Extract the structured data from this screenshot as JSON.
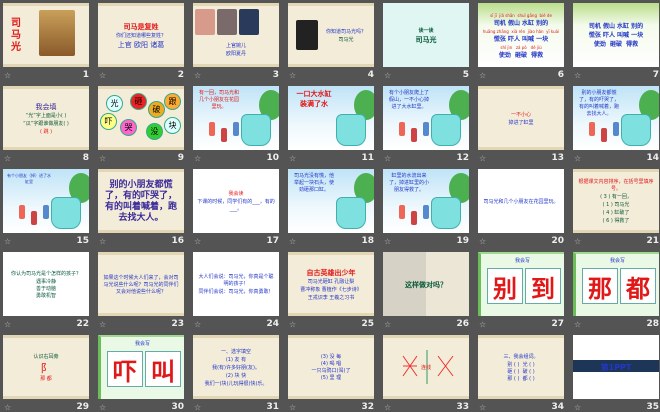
{
  "view": "slide-sorter",
  "slides": [
    {
      "number": "1",
      "theme": "parch",
      "texts": [
        {
          "v": "司\n马\n光",
          "c": "red big",
          "s": 10
        }
      ],
      "extra": "portrait"
    },
    {
      "number": "2",
      "theme": "parch",
      "texts": [
        {
          "v": "司马是复姓",
          "c": "red big",
          "s": 7
        },
        {
          "v": "你们还知道哪些复姓？",
          "c": "blue",
          "s": 5
        },
        {
          "v": "上官 欧阳 诸葛",
          "c": "blue",
          "s": 7
        }
      ]
    },
    {
      "number": "3",
      "theme": "parch",
      "texts": [
        {
          "v": "上官婉儿",
          "c": "blue",
          "s": 5
        },
        {
          "v": "欧阳夏丹",
          "c": "blue",
          "s": 5
        }
      ],
      "extra": "photos"
    },
    {
      "number": "4",
      "theme": "parch",
      "texts": [
        {
          "v": "你知道司马光吗？",
          "c": "blue",
          "s": 5
        },
        {
          "v": "司马光",
          "c": "dk",
          "s": 5
        }
      ],
      "extra": "portrait2"
    },
    {
      "number": "5",
      "theme": "mint",
      "texts": [
        {
          "v": "读一读",
          "c": "dk big",
          "s": 5
        },
        {
          "v": "司马光",
          "c": "dk big",
          "s": 7
        }
      ]
    },
    {
      "number": "6",
      "theme": "leaf",
      "texts": [
        {
          "v": "sī jī  jiǎ shān  shuǐ gāng  bié de",
          "c": "red",
          "s": 4
        },
        {
          "v": "司机 假山 水缸 别的",
          "c": "blue big",
          "s": 6
        },
        {
          "v": "huāng zhāng  xià rén  jiào hǎn  yī kuài",
          "c": "red",
          "s": 4
        },
        {
          "v": "慌张 吓人 叫喊 一块",
          "c": "blue big",
          "s": 6
        },
        {
          "v": "shǐ jìn   zá pò   dé jiù",
          "c": "red",
          "s": 4
        },
        {
          "v": "使劲  砸破  得救",
          "c": "blue big",
          "s": 6
        }
      ]
    },
    {
      "number": "7",
      "theme": "leaf",
      "texts": [
        {
          "v": "司机 假山 水缸 别的",
          "c": "blue big",
          "s": 6
        },
        {
          "v": "慌张 吓人 叫喊 一块",
          "c": "blue big",
          "s": 6
        },
        {
          "v": "使劲  砸破  得救",
          "c": "blue big",
          "s": 6
        }
      ]
    },
    {
      "number": "8",
      "theme": "parch",
      "texts": [
        {
          "v": "我会填",
          "c": "pur",
          "s": 7
        },
        {
          "v": "“光”字上面是小( )",
          "c": "dk",
          "s": 5
        },
        {
          "v": "“瓜”字跟谁做朋友( )",
          "c": "dk",
          "s": 5
        },
        {
          "v": "( 跳 )",
          "c": "red",
          "s": 5
        }
      ]
    },
    {
      "number": "9",
      "theme": "parch",
      "texts": [],
      "extra": "circles",
      "circles": [
        "光",
        "砸",
        "破",
        "跟",
        "吓",
        "哭",
        "没",
        "块"
      ]
    },
    {
      "number": "10",
      "theme": "sky",
      "texts": [
        {
          "v": "有一回，司马光和几个小朋友在花园里玩。",
          "c": "red",
          "s": 5
        }
      ],
      "extra": "scene"
    },
    {
      "number": "11",
      "theme": "sky",
      "texts": [
        {
          "v": "一口大水缸",
          "c": "red big",
          "s": 7
        },
        {
          "v": "装满了水",
          "c": "red big",
          "s": 7
        }
      ],
      "extra": "jar"
    },
    {
      "number": "12",
      "theme": "sky",
      "texts": [
        {
          "v": "有个小朋友爬上了假山，一不小心掉进了大水缸里。",
          "c": "blue",
          "s": 5
        }
      ],
      "extra": "scene"
    },
    {
      "number": "13",
      "theme": "parch",
      "texts": [
        {
          "v": "一不小心",
          "c": "red",
          "s": 5
        },
        {
          "v": "掉进了缸里",
          "c": "blue",
          "s": 5
        }
      ]
    },
    {
      "number": "14",
      "theme": "sky",
      "texts": [
        {
          "v": "别的小朋友都慌了，有的吓哭了，有的叫着喊着，跑去找大人。",
          "c": "blue",
          "s": 5
        }
      ],
      "extra": "scene"
    },
    {
      "number": "15",
      "theme": "sky",
      "texts": [
        {
          "v": "有个小朋友（掉）进了水缸里",
          "c": "blue",
          "s": 4
        }
      ],
      "extra": "scene"
    },
    {
      "number": "16",
      "theme": "parch",
      "texts": [
        {
          "v": "别的小朋友都慌了，有的吓哭了，有的叫着喊着，跑去找大人。",
          "c": "pur big",
          "s": 9
        }
      ]
    },
    {
      "number": "17",
      "theme": "white",
      "texts": [
        {
          "v": "我会读",
          "c": "red",
          "s": 5
        },
        {
          "v": "下课的时候，同学们有的___，有的___。",
          "c": "blue",
          "s": 5
        }
      ]
    },
    {
      "number": "18",
      "theme": "sky",
      "texts": [
        {
          "v": "司马光没有慌，他举起一块石头，使劲砸那口缸。",
          "c": "blue",
          "s": 5
        }
      ],
      "extra": "jar"
    },
    {
      "number": "19",
      "theme": "sky",
      "texts": [
        {
          "v": "缸里的水流出来了，掉进缸里的小朋友得救了。",
          "c": "blue",
          "s": 5
        }
      ],
      "extra": "scene"
    },
    {
      "number": "20",
      "theme": "white",
      "texts": [
        {
          "v": "司马光和几个小朋友在花园里玩。",
          "c": "blue",
          "s": 5
        }
      ]
    },
    {
      "number": "21",
      "theme": "parch",
      "texts": [
        {
          "v": "根据课文内容排序，在括号里填序号。",
          "c": "red",
          "s": 5
        },
        {
          "v": "( 3 ) 有一回，",
          "c": "dk",
          "s": 5
        },
        {
          "v": "( 1 ) 司马光",
          "c": "dk",
          "s": 5
        },
        {
          "v": "( 4 ) 缸破了",
          "c": "dk",
          "s": 5
        },
        {
          "v": "( 6 ) 得救了",
          "c": "dk",
          "s": 5
        }
      ]
    },
    {
      "number": "22",
      "theme": "white",
      "texts": [
        {
          "v": "你认为司马光是个怎样的孩子？",
          "c": "dk",
          "s": 5
        },
        {
          "v": "遇事冷静\n善于动脑\n勇敢机智",
          "c": "dk",
          "s": 5
        }
      ]
    },
    {
      "number": "23",
      "theme": "parch",
      "texts": [
        {
          "v": "如果这个时候大人们来了，会对司马光说些什么呢？司马光的同伴们又会对他说些什么呢？",
          "c": "blue",
          "s": 5
        }
      ]
    },
    {
      "number": "24",
      "theme": "white",
      "texts": [
        {
          "v": "大人们会说：司马光，你真是个聪明的孩子！",
          "c": "blue",
          "s": 5
        },
        {
          "v": "同伴们会说：司马光，你真勇敢！",
          "c": "blue",
          "s": 5
        }
      ]
    },
    {
      "number": "25",
      "theme": "parch",
      "texts": [
        {
          "v": "自古英雄出少年",
          "c": "red big",
          "s": 7
        },
        {
          "v": "司马光砸缸 孔融让梨",
          "c": "blue",
          "s": 5
        },
        {
          "v": "曹冲称象 曹植作《七步诗》",
          "c": "blue",
          "s": 5
        },
        {
          "v": "王戎识李 王羲之习书",
          "c": "blue",
          "s": 5
        }
      ]
    },
    {
      "number": "26",
      "theme": "photo",
      "texts": [
        {
          "v": "这样做对吗？",
          "c": "dk big",
          "s": 7
        }
      ]
    },
    {
      "number": "27",
      "theme": "green",
      "texts": [
        {
          "v": "我会写",
          "c": "blue",
          "s": 5
        }
      ],
      "chars": [
        "别",
        "到"
      ]
    },
    {
      "number": "28",
      "theme": "green",
      "texts": [
        {
          "v": "我会写",
          "c": "blue",
          "s": 5
        }
      ],
      "chars": [
        "那",
        "都"
      ]
    },
    {
      "number": "29",
      "theme": "parch",
      "texts": [
        {
          "v": "认识右耳旁",
          "c": "dk",
          "s": 5
        },
        {
          "v": "阝",
          "c": "red",
          "s": 11
        },
        {
          "v": "那 都",
          "c": "red",
          "s": 5
        }
      ]
    },
    {
      "number": "30",
      "theme": "green",
      "texts": [
        {
          "v": "我会写",
          "c": "blue",
          "s": 5
        }
      ],
      "chars": [
        "吓",
        "叫"
      ]
    },
    {
      "number": "31",
      "theme": "parch",
      "texts": [
        {
          "v": "一、选字填空",
          "c": "blue",
          "s": 5
        },
        {
          "v": "(1) 友 有",
          "c": "blue",
          "s": 5
        },
        {
          "v": "我(有)许多好朋(友)。",
          "c": "blue",
          "s": 5
        },
        {
          "v": "(2) 块 快",
          "c": "blue",
          "s": 5
        },
        {
          "v": "我们一(块)儿玩得很(快)乐。",
          "c": "blue",
          "s": 5
        }
      ]
    },
    {
      "number": "32",
      "theme": "parch",
      "texts": [
        {
          "v": "(3) 没 每\n(4) 喝 唱\n一只乌鸦口(渴)了\n(5) 里 理",
          "c": "blue",
          "s": 5
        }
      ]
    },
    {
      "number": "33",
      "theme": "parch",
      "texts": [
        {
          "v": "连线",
          "c": "red",
          "s": 5
        }
      ],
      "extra": "lines"
    },
    {
      "number": "34",
      "theme": "parch",
      "texts": [
        {
          "v": "三、我会组词。",
          "c": "blue",
          "s": 5
        },
        {
          "v": "别 ( )  光 ( )\n砸 ( )  破 ( )\n那 ( )  都 ( )",
          "c": "blue",
          "s": 5
        }
      ]
    },
    {
      "number": "35",
      "theme": "white",
      "texts": [
        {
          "v": "第1PPT",
          "c": "blue big",
          "s": 8
        }
      ],
      "extra": "ppt"
    }
  ]
}
